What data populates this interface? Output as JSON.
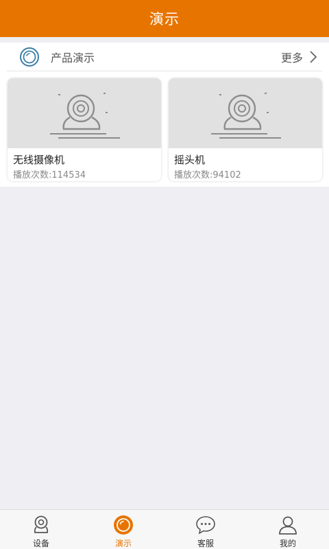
{
  "header": {
    "title": "演示"
  },
  "section": {
    "title": "产品演示",
    "more_label": "更多"
  },
  "cards": [
    {
      "title": "无线摄像机",
      "plays": "播放次数:114534"
    },
    {
      "title": "摇头机",
      "plays": "播放次数:94102"
    }
  ],
  "tabs": [
    {
      "label": "设备",
      "icon": "camera-icon",
      "active": false
    },
    {
      "label": "演示",
      "icon": "demo-icon",
      "active": true
    },
    {
      "label": "客服",
      "icon": "chat-icon",
      "active": false
    },
    {
      "label": "我的",
      "icon": "user-icon",
      "active": false
    }
  ],
  "colors": {
    "accent": "#e87400",
    "section_icon": "#3b7fa8"
  }
}
